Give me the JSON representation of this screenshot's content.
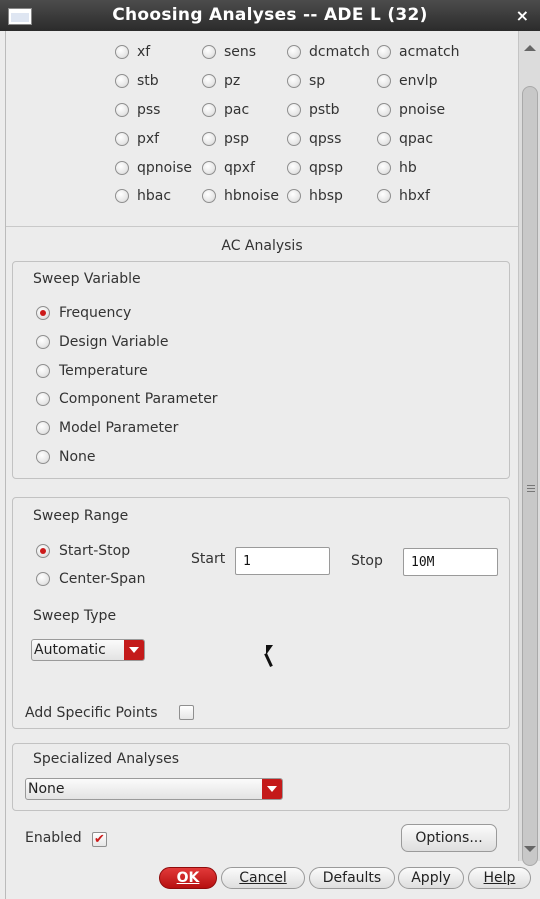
{
  "window": {
    "title": "Choosing Analyses -- ADE L (32)",
    "close_glyph": "×"
  },
  "analyses": [
    [
      "xf",
      "sens",
      "dcmatch",
      "acmatch"
    ],
    [
      "stb",
      "pz",
      "sp",
      "envlp"
    ],
    [
      "pss",
      "pac",
      "pstb",
      "pnoise"
    ],
    [
      "pxf",
      "psp",
      "qpss",
      "qpac"
    ],
    [
      "qpnoise",
      "qpxf",
      "qpsp",
      "hb"
    ],
    [
      "hbac",
      "hbnoise",
      "hbsp",
      "hbxf"
    ]
  ],
  "section_title": "AC Analysis",
  "sweep_variable": {
    "title": "Sweep Variable",
    "options": [
      "Frequency",
      "Design Variable",
      "Temperature",
      "Component Parameter",
      "Model Parameter",
      "None"
    ],
    "selected": "Frequency"
  },
  "sweep_range": {
    "title": "Sweep Range",
    "options": [
      "Start-Stop",
      "Center-Span"
    ],
    "selected": "Start-Stop",
    "start_label": "Start",
    "start_value": "1",
    "stop_label": "Stop",
    "stop_value": "10M",
    "sweep_type_label": "Sweep Type",
    "sweep_type_value": "Automatic",
    "add_points_label": "Add Specific Points",
    "add_points_checked": false
  },
  "specialized": {
    "title": "Specialized Analyses",
    "value": "None"
  },
  "enabled": {
    "label": "Enabled",
    "checked": true,
    "check_glyph": "✔"
  },
  "buttons": {
    "options": "Options...",
    "ok": "OK",
    "cancel": "Cancel",
    "defaults": "Defaults",
    "apply": "Apply",
    "help": "Help"
  },
  "colors": {
    "accent": "#cc1b1b",
    "titlebar": "#3a3a3a"
  }
}
